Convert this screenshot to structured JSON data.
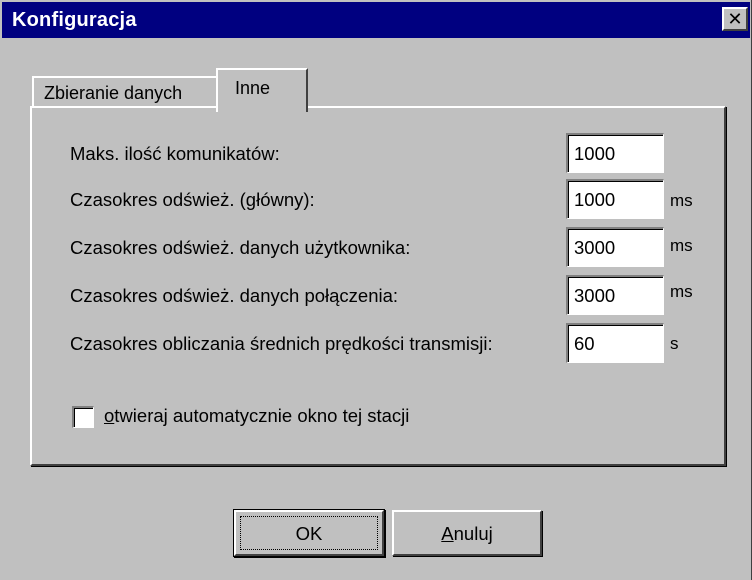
{
  "window": {
    "title": "Konfiguracja",
    "close_glyph": "✕"
  },
  "tabs": [
    {
      "label": "Zbieranie danych",
      "active": false
    },
    {
      "label": "Inne",
      "active": true
    }
  ],
  "fields": [
    {
      "label": "Maks. ilość komunikatów:",
      "value": "1000",
      "unit": ""
    },
    {
      "label": "Czasokres odśwież. (główny):",
      "value": "1000",
      "unit": "ms"
    },
    {
      "label": "Czasokres odśwież. danych użytkownika:",
      "value": "3000",
      "unit": "ms"
    },
    {
      "label": "Czasokres odśwież. danych połączenia:",
      "value": "3000",
      "unit": "ms"
    },
    {
      "label": "Czasokres obliczania średnich prędkości transmisji:",
      "value": "60",
      "unit": "s"
    }
  ],
  "checkbox": {
    "label_mnemonic": "o",
    "label_rest": "twieraj automatycznie okno tej stacji",
    "checked": false
  },
  "buttons": {
    "ok": {
      "label": "OK"
    },
    "cancel": {
      "label_mnemonic": "A",
      "label_rest": "nuluj"
    }
  },
  "colors": {
    "titlebar": "#000080",
    "face": "#c0c0c0"
  }
}
